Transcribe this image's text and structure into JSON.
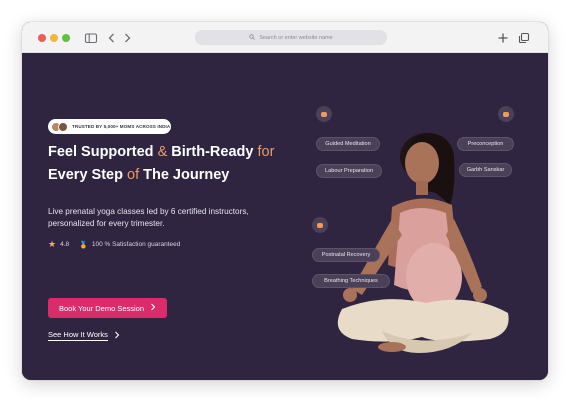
{
  "browser": {
    "address_placeholder": "Search or enter website name",
    "icons": [
      "sidebar-icon",
      "back-icon",
      "forward-icon",
      "search-icon",
      "new-tab-icon",
      "tabs-overview-icon"
    ]
  },
  "hero": {
    "trust_badge": "TRUSTED BY 5,000+ MOMS ACROSS INDIA",
    "headline": {
      "line1_a": "Feel Supported ",
      "line1_amp": "&",
      "line1_b": " Birth-Ready ",
      "line1_for": "for",
      "line2_a": "Every Step ",
      "line2_of": "of",
      "line2_b": " The Journey"
    },
    "subtext_line1": "Live prenatal yoga classes led by 6 certified instructors,",
    "subtext_line2": "personalized for every trimester.",
    "rating_value": "4.8",
    "satisfaction": "100 % Satisfaction guaranteed",
    "cta_label": "Book Your Demo Session",
    "secondary_link": "See How It Works"
  },
  "tags": {
    "guided_meditation": "Guided Meditation",
    "labour_preparation": "Labour Preparation",
    "preconception": "Preconception",
    "garbh_sanskar": "Garbh Sanskar",
    "postnatal_recovery": "Postnatal Recovery",
    "breathing_techniques": "Breathing Techniques"
  },
  "colors": {
    "background": "#2f2540",
    "accent": "#ec9a6a",
    "cta": "#db2b6a",
    "star": "#f3b43b"
  }
}
